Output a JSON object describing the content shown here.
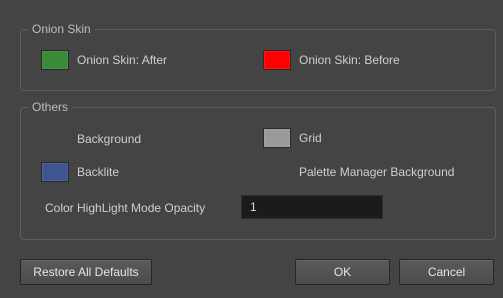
{
  "onion_skin": {
    "title": "Onion Skin",
    "after": {
      "label": "Onion Skin: After",
      "color": "#3a8a3a"
    },
    "before": {
      "label": "Onion Skin: Before",
      "color": "#ff0000"
    }
  },
  "others": {
    "title": "Others",
    "background_label": "Background",
    "grid": {
      "label": "Grid",
      "color": "#9a9a9a"
    },
    "backlite": {
      "label": "Backlite",
      "color": "#3f5590"
    },
    "palette_manager_label": "Palette Manager Background",
    "highlight_opacity": {
      "label": "Color HighLight Mode Opacity",
      "value": "1"
    }
  },
  "buttons": {
    "restore_label": "Restore All Defaults",
    "ok_label": "OK",
    "cancel_label": "Cancel"
  }
}
